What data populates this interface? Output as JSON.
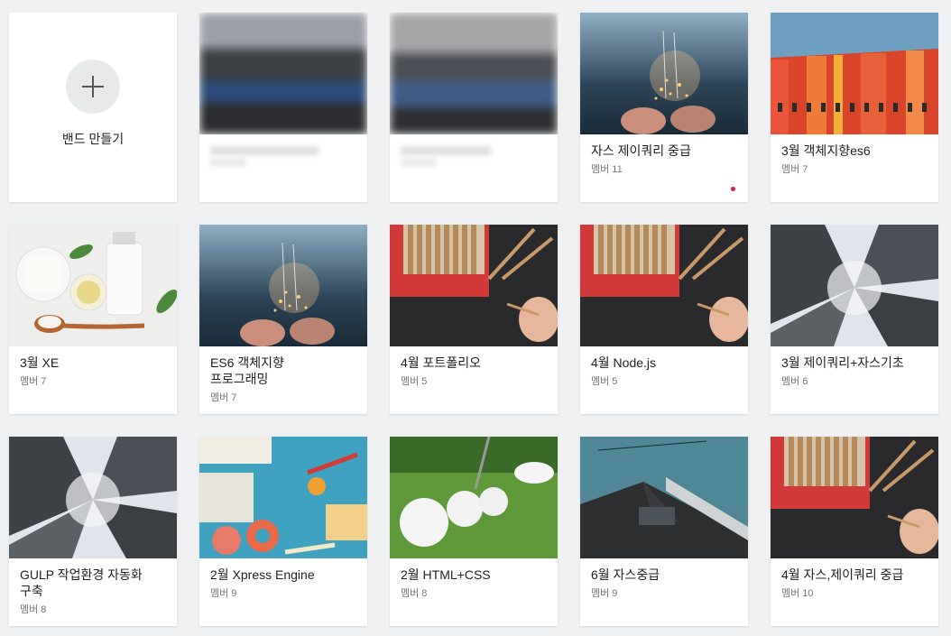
{
  "create": {
    "label": "밴드 만들기",
    "icon": "plus-icon"
  },
  "bands": [
    {
      "name": "",
      "members": ""
    },
    {
      "name": "",
      "members": ""
    },
    {
      "name": "자스 제이쿼리 중급",
      "members": "멤버 11",
      "new_dot": true
    },
    {
      "name": "3월 객체지향es6",
      "members": "멤버 7"
    },
    {
      "name": "3월 XE",
      "members": "멤버 7"
    },
    {
      "name": "ES6 객체지향\n프로그래밍",
      "members": "멤버 7"
    },
    {
      "name": "4월 포트폴리오",
      "members": "멤버 5"
    },
    {
      "name": "4월 Node.js",
      "members": "멤버 5"
    },
    {
      "name": "3월 제이쿼리+자스기초",
      "members": "멤버 6"
    },
    {
      "name": "GULP 작업환경 자동화\n구축",
      "members": "멤버 8"
    },
    {
      "name": "2월 Xpress Engine",
      "members": "멤버 9"
    },
    {
      "name": "2월 HTML+CSS",
      "members": "멤버 8"
    },
    {
      "name": "6월 자스중급",
      "members": "멤버 9"
    },
    {
      "name": "4월 자스,제이쿼리 중급",
      "members": "멤버 10"
    }
  ],
  "colors": {
    "new_dot": "#e4173e",
    "background": "#eef0f2"
  }
}
